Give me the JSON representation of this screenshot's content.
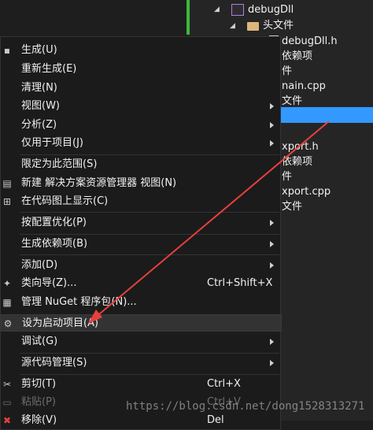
{
  "tree": {
    "project": "debugDll",
    "folder_header": "头文件",
    "rows": [
      "debugDll.h",
      "依赖项",
      "件",
      "nain.cpp",
      "文件",
      "",
      "xport.h",
      "依赖项",
      "件",
      "xport.cpp",
      "文件"
    ]
  },
  "menu": {
    "items": [
      {
        "label": "生成(U)"
      },
      {
        "label": "重新生成(E)"
      },
      {
        "label": "清理(N)"
      },
      {
        "label": "视图(W)"
      },
      {
        "label": "分析(Z)"
      },
      {
        "label": "仅用于项目(J)"
      },
      {
        "label": "限定为此范围(S)"
      },
      {
        "label": "新建 解决方案资源管理器 视图(N)"
      },
      {
        "label": "在代码图上显示(C)"
      },
      {
        "label": "按配置优化(P)"
      },
      {
        "label": "生成依赖项(B)"
      },
      {
        "label": "添加(D)"
      },
      {
        "label": "类向导(Z)...",
        "shortcut": "Ctrl+Shift+X"
      },
      {
        "label": "管理 NuGet 程序包(N)..."
      },
      {
        "label": "设为启动项目(A)"
      },
      {
        "label": "调试(G)"
      },
      {
        "label": "源代码管理(S)"
      },
      {
        "label": "剪切(T)",
        "shortcut": "Ctrl+X"
      },
      {
        "label": "粘贴(P)",
        "shortcut": "Ctrl+V"
      },
      {
        "label": "移除(V)",
        "shortcut": "Del"
      }
    ]
  },
  "watermark": "https://blog.csdn.net/dong1528313271",
  "colors": {
    "accent": "#3399ff",
    "arrow": "#e8403c",
    "menu_bg": "#1b1b1c"
  }
}
